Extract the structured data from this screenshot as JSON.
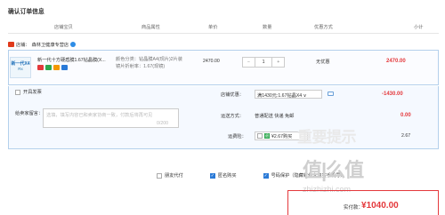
{
  "page": {
    "title": "确认订单信息"
  },
  "table_header": {
    "col1": "店铺宝贝",
    "col2": "商品属性",
    "col3": "单价",
    "col4": "数量",
    "col5": "优惠方式",
    "col6": "小计"
  },
  "shop": {
    "prefix": "店铺：",
    "name": "森林卫健康专营店"
  },
  "item": {
    "thumb_brand": "新一代X4",
    "thumb_sub": "Rx",
    "name": "新一代十方硬盾膜1.67钻晶膜(X...",
    "attr_line1": "颜色分类：钻晶膜A4(现片)2片装",
    "attr_line2": "镜片折射率：1.67(现镜)",
    "unit_price": "2470.00",
    "quantity": "1",
    "minus": "−",
    "plus": "+",
    "promo": "无优惠",
    "subtotal": "2470.00"
  },
  "invoice": {
    "label": "开具发票"
  },
  "message": {
    "label": "给卖家留言：",
    "placeholder": "选填，填写内容已和卖家协商一致，付款后将再可见",
    "counter": "0/200"
  },
  "voucher": {
    "label": "店铺优惠：",
    "selected": "满1430元:1.67钻晶X4 ∨",
    "amount": "-1430.00"
  },
  "shipping": {
    "label": "运送方式：",
    "value": "普通配送 快递 免邮",
    "amount": "0.00"
  },
  "insurance": {
    "label": "运费险：",
    "badge": "退",
    "value": "¥2.67购买",
    "amount": "2.67"
  },
  "options": {
    "friend_pay": "朋友代付",
    "anonymous": "匿名购买",
    "privacy": "号码保护（隐藏收件人真实手机号）"
  },
  "watermark": {
    "w1": "重要提示",
    "w2": "值|么值",
    "w3": "zhizhizhi.com"
  },
  "pay": {
    "label": "实付款：",
    "currency": "¥",
    "amount": "1040.00"
  },
  "colors": {
    "accent": "#e4393c",
    "blue": "#2a7ad7",
    "border": "#b4d0ec"
  }
}
